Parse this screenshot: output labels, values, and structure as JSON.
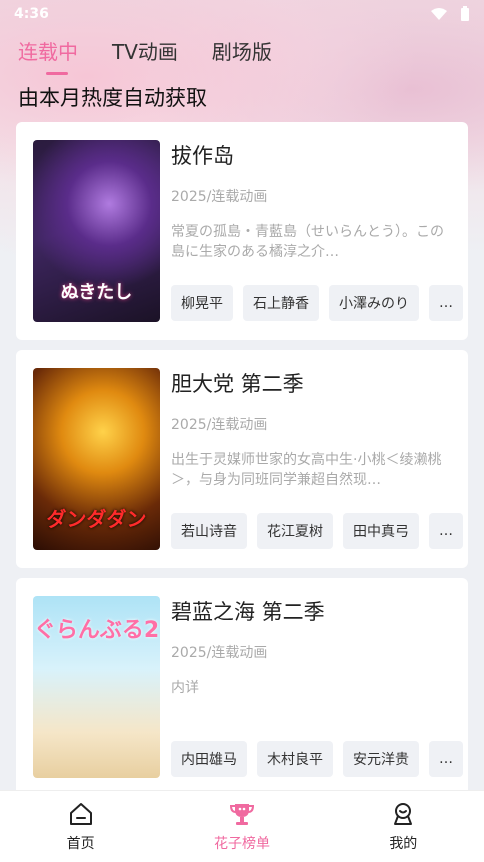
{
  "status_bar": {
    "time": "4:36"
  },
  "tabs": [
    {
      "label": "连载中",
      "active": true
    },
    {
      "label": "TV动画",
      "active": false
    },
    {
      "label": "剧场版",
      "active": false
    }
  ],
  "subtitle": "由本月热度自动获取",
  "cards": [
    {
      "title": "拔作岛",
      "meta": "2025/连载动画",
      "desc": "常夏の孤島・青藍島（せいらんとう）。この島に生家のある橘淳之介…",
      "poster_text": "ぬきたし",
      "cast": [
        "柳晃平",
        "石上静香",
        "小澤みのり",
        "…"
      ]
    },
    {
      "title": "胆大党 第二季",
      "meta": "2025/连载动画",
      "desc": "出生于灵媒师世家的女高中生·小桃＜绫濑桃＞，与身为同班同学兼超自然现…",
      "poster_text": "ダンダダン",
      "cast": [
        "若山诗音",
        "花江夏树",
        "田中真弓",
        "…"
      ]
    },
    {
      "title": "碧蓝之海 第二季",
      "meta": "2025/连载动画",
      "desc": "内详",
      "poster_text": "ぐらんぶる2",
      "cast": [
        "内田雄马",
        "木村良平",
        "安元洋贵",
        "…"
      ]
    }
  ],
  "bottom_nav": [
    {
      "label": "首页",
      "icon": "home-icon",
      "active": false
    },
    {
      "label": "花子榜单",
      "icon": "trophy-icon",
      "active": true
    },
    {
      "label": "我的",
      "icon": "user-icon",
      "active": false
    }
  ],
  "colors": {
    "accent": "#f06aa0",
    "page_bg": "#eef0f4",
    "chip_bg": "#eff1f5"
  }
}
